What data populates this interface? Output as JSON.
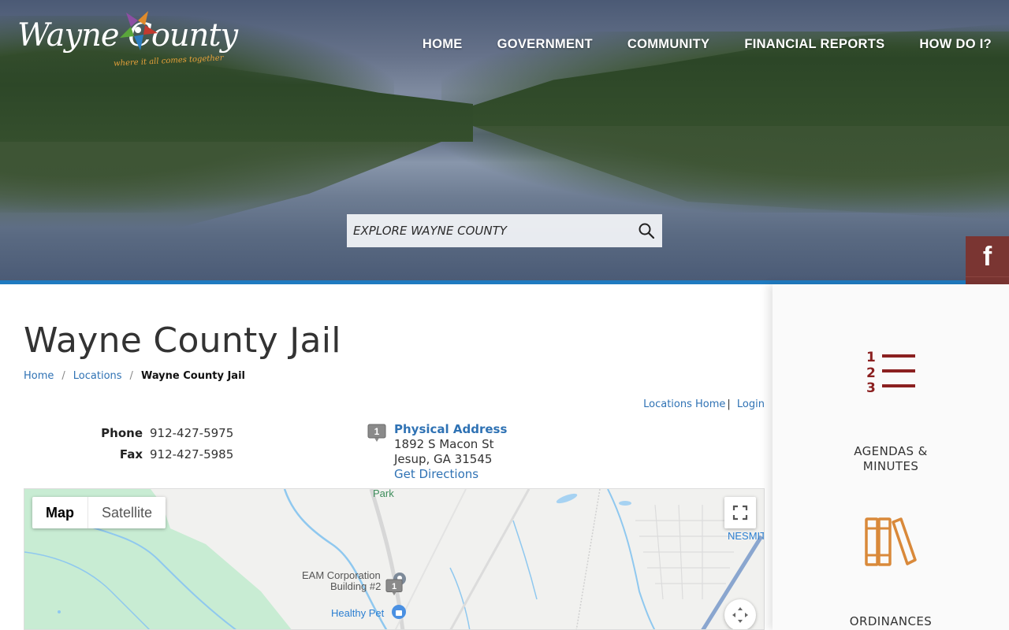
{
  "site": {
    "logo_text": "Wayne County",
    "logo_tagline": "where it all comes together"
  },
  "nav": {
    "items": [
      {
        "label": "HOME"
      },
      {
        "label": "GOVERNMENT"
      },
      {
        "label": "COMMUNITY"
      },
      {
        "label": "FINANCIAL REPORTS"
      },
      {
        "label": "HOW DO I?"
      }
    ]
  },
  "search": {
    "placeholder": "EXPLORE WAYNE COUNTY"
  },
  "social": {
    "facebook_label": "f"
  },
  "page": {
    "title": "Wayne County Jail",
    "breadcrumb": {
      "items": [
        "Home",
        "Locations"
      ],
      "current": "Wayne County Jail"
    },
    "util_links": {
      "locations_home": "Locations Home",
      "login": "Login"
    },
    "contacts": [
      {
        "label": "Phone",
        "value": "912-427-5975"
      },
      {
        "label": "Fax",
        "value": "912-427-5985"
      }
    ],
    "address": {
      "marker": "1",
      "title": "Physical Address",
      "line1": "1892 S Macon St",
      "line2": "Jesup, GA 31545",
      "directions": "Get Directions"
    }
  },
  "map": {
    "types": [
      "Map",
      "Satellite"
    ],
    "selected_type": "Map",
    "labels": {
      "park": "Park",
      "eam_line1": "EAM Corporation",
      "eam_line2": "Building #2",
      "healthy_pet": "Healthy Pet",
      "nesmith": "NESMIT"
    },
    "marker": "1"
  },
  "sidebar": {
    "quick_links": [
      {
        "label_line1": "AGENDAS &",
        "label_line2": "MINUTES",
        "icon": "numbered-list-icon"
      },
      {
        "label_line1": "ORDINANCES",
        "label_line2": "",
        "icon": "books-icon"
      }
    ]
  },
  "colors": {
    "accent_blue": "#1f7ac0",
    "link_blue": "#2f72b4",
    "maroon": "#7a3532",
    "icon_red": "#8b2020",
    "icon_orange": "#d9893a"
  }
}
